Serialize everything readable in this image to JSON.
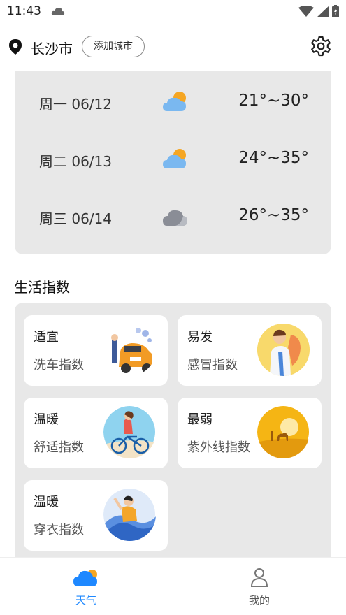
{
  "status_bar": {
    "time": "11:43",
    "icons": [
      "cloud-icon",
      "wifi-icon",
      "signal-icon",
      "battery-icon"
    ]
  },
  "header": {
    "city": "长沙市",
    "add_city_label": "添加城市",
    "settings_icon": "gear-icon",
    "location_icon": "location-pin-icon"
  },
  "forecast": [
    {
      "day": "周一 06/12",
      "icon": "partly-cloudy-icon",
      "temp": "21°~30°"
    },
    {
      "day": "周二 06/13",
      "icon": "partly-cloudy-icon",
      "temp": "24°~35°"
    },
    {
      "day": "周三 06/14",
      "icon": "cloudy-icon",
      "temp": "26°~35°"
    }
  ],
  "life_index": {
    "title": "生活指数",
    "items": [
      {
        "level": "适宜",
        "name": "洗车指数",
        "image": "car-wash-illustration"
      },
      {
        "level": "易发",
        "name": "感冒指数",
        "image": "cold-doctor-illustration"
      },
      {
        "level": "温暖",
        "name": "舒适指数",
        "image": "cycling-illustration"
      },
      {
        "level": "最弱",
        "name": "紫外线指数",
        "image": "desert-sun-illustration"
      },
      {
        "level": "温暖",
        "name": "穿衣指数",
        "image": "clothing-illustration"
      }
    ]
  },
  "bottom_nav": [
    {
      "label": "天气",
      "icon": "weather-cloud-icon",
      "active": true
    },
    {
      "label": "我的",
      "icon": "user-icon",
      "active": false
    }
  ],
  "colors": {
    "accent": "#1e88ff",
    "sun": "#f5a623",
    "card_bg": "#e8e8e8",
    "inactive": "#777777"
  }
}
